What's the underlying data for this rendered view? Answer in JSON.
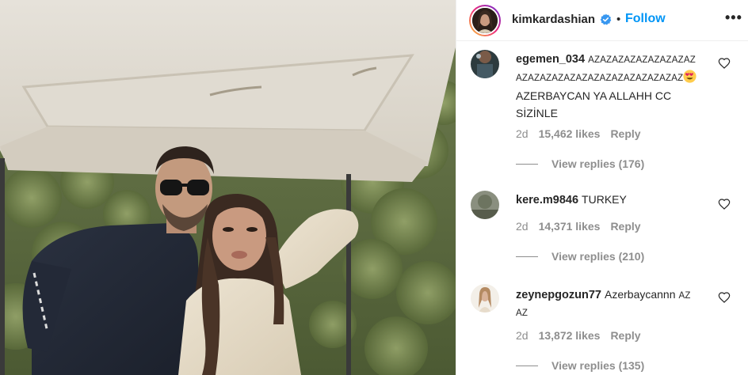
{
  "header": {
    "username": "kimkardashian",
    "separator": "•",
    "follow_label": "Follow",
    "more_label": "•••",
    "verified_icon": "verified-badge-icon",
    "colors": {
      "follow": "#0095f6",
      "text": "#262626",
      "muted": "#8e8e8e"
    }
  },
  "comments": [
    {
      "username": "egemen_034",
      "text_line1": "AZAZAZAZAZAZAZAZAZ",
      "text_line2": "AZAZAZAZAZAZAZAZAZAZAZAZAZAZ",
      "emoji": "smiling-face-with-heart-eyes",
      "text_line3": "AZERBAYCAN YA ALLAHH CC",
      "text_line4": "SİZİNLE",
      "age": "2d",
      "likes": "15,462 likes",
      "reply_label": "Reply",
      "view_replies": "View replies (176)"
    },
    {
      "username": "kere.m9846",
      "text_line1": "TURKEY",
      "age": "2d",
      "likes": "14,371 likes",
      "reply_label": "Reply",
      "view_replies": "View replies (210)"
    },
    {
      "username": "zeynepgozun77",
      "text_line1": "Azerbaycannn",
      "text_line1b": "AZ",
      "text_line2": "AZ",
      "age": "2d",
      "likes": "13,872 likes",
      "reply_label": "Reply",
      "view_replies": "View replies (135)"
    }
  ]
}
